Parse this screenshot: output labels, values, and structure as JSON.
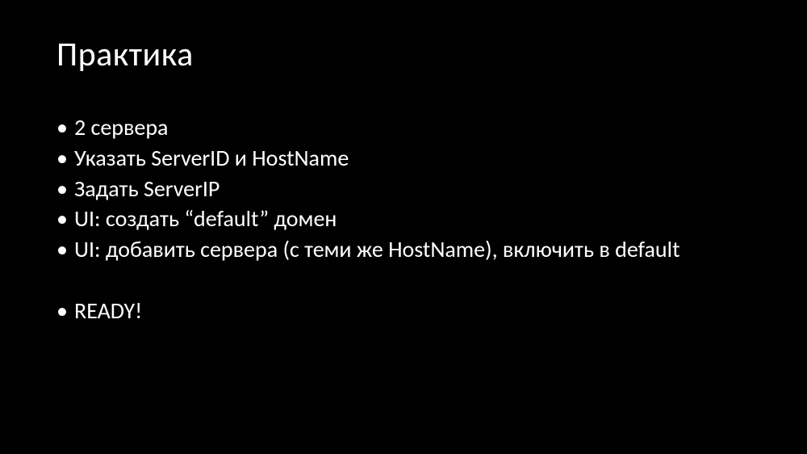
{
  "slide": {
    "title": "Практика",
    "bullets": [
      "2 сервера",
      "Указать ServerID и HostName",
      "Задать ServerIP",
      "UI: создать “default” домен",
      "UI: добавить сервера (с теми же HostName), включить в default"
    ],
    "finalBullet": "READY!"
  }
}
